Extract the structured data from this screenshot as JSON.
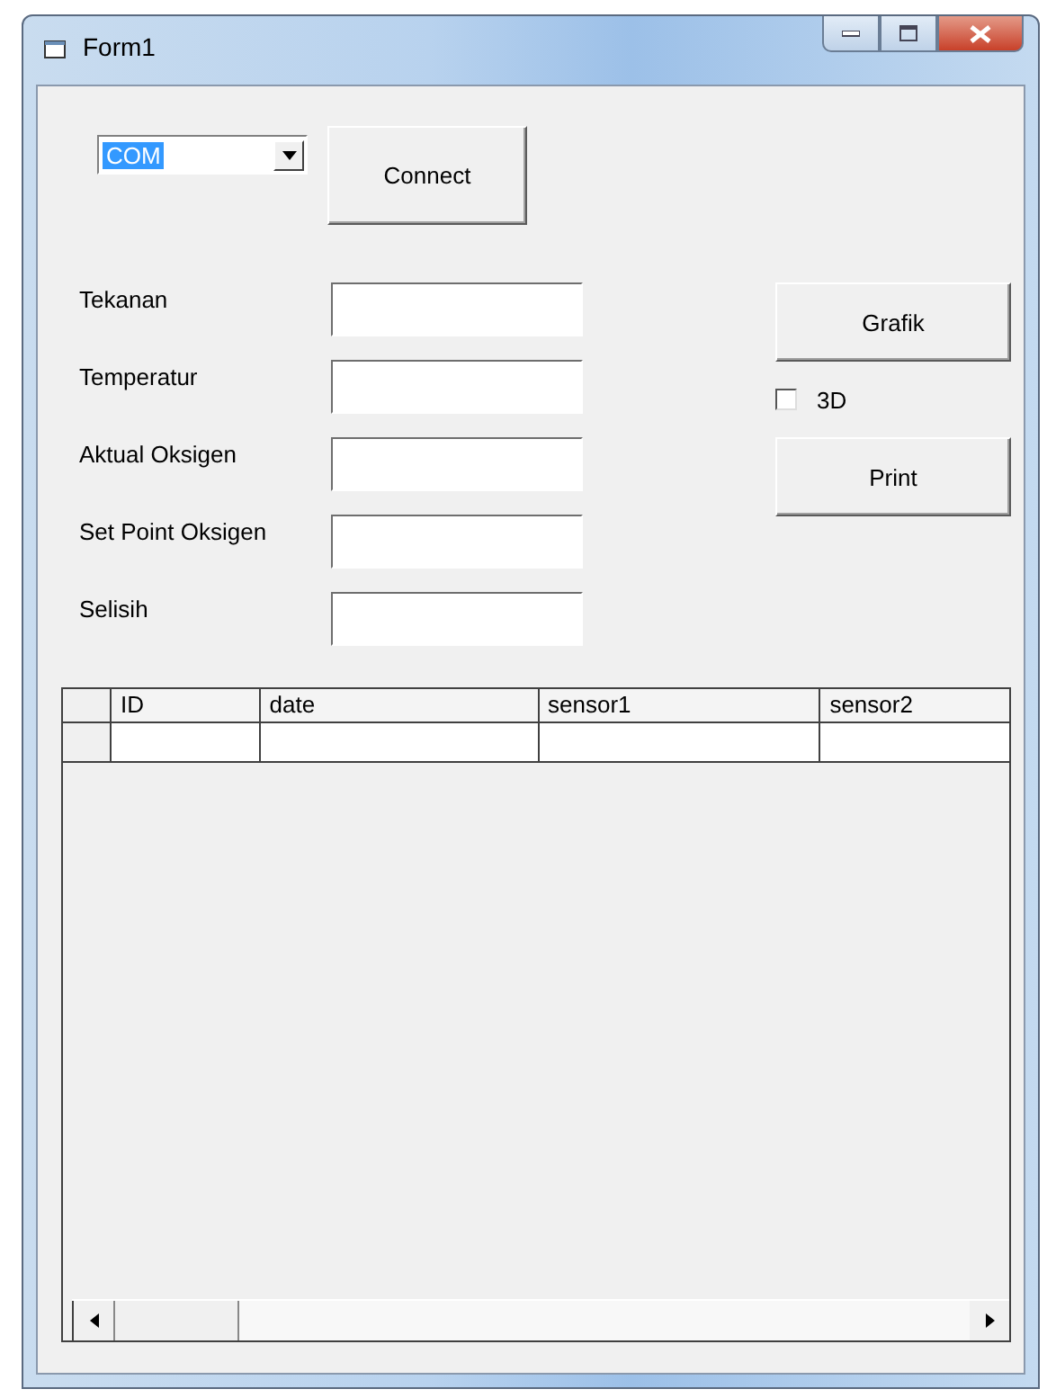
{
  "window": {
    "title": "Form1"
  },
  "port_combo": {
    "value": "COM",
    "text_selected": true
  },
  "connect_button": {
    "label": "Connect"
  },
  "fields": [
    {
      "label": "Tekanan"
    },
    {
      "label": "Temperatur"
    },
    {
      "label": "Aktual Oksigen"
    },
    {
      "label": "Set Point Oksigen"
    },
    {
      "label": "Selisih"
    }
  ],
  "graph_button": {
    "label": "Grafik"
  },
  "checkbox_3d": {
    "label": "3D",
    "checked": false
  },
  "print_button": {
    "label": "Print"
  },
  "grid": {
    "columns": [
      "ID",
      "date",
      "sensor1",
      "sensor2"
    ]
  }
}
